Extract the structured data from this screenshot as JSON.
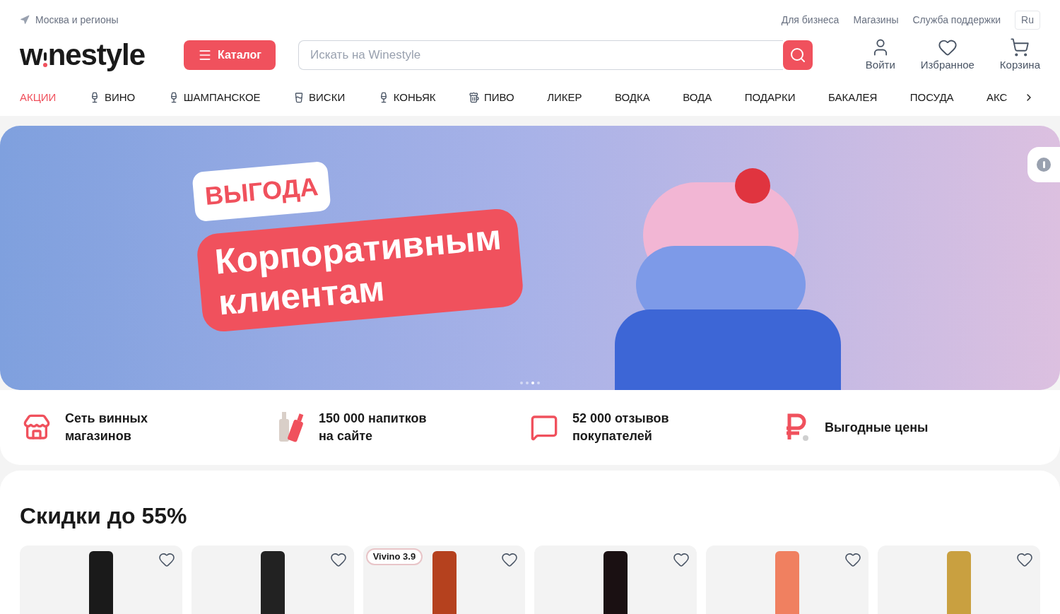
{
  "topbar": {
    "location": "Москва и регионы",
    "links": [
      "Для бизнеса",
      "Магазины",
      "Служба поддержки"
    ],
    "language": "Ru"
  },
  "header": {
    "logo": {
      "before": "w",
      "after": "nestyle"
    },
    "catalog_button": "Каталог",
    "search": {
      "placeholder": "Искать на Winestyle"
    },
    "actions": [
      {
        "kind": "user",
        "label": "Войти"
      },
      {
        "kind": "heart",
        "label": "Избранное"
      },
      {
        "kind": "cart",
        "label": "Корзина"
      }
    ]
  },
  "nav": [
    {
      "label": "АКЦИИ",
      "accent": true
    },
    {
      "label": "ВИНО",
      "accent": false
    },
    {
      "label": "ШАМПАНСКОЕ",
      "accent": false
    },
    {
      "label": "ВИСКИ",
      "accent": false
    },
    {
      "label": "КОНЬЯК",
      "accent": false
    },
    {
      "label": "ПИВО",
      "accent": false
    },
    {
      "label": "ЛИКЕР",
      "accent": false
    },
    {
      "label": "ВОДКА",
      "accent": false
    },
    {
      "label": "ВОДА",
      "accent": false
    },
    {
      "label": "ПОДАРКИ",
      "accent": false
    },
    {
      "label": "БАКАЛЕЯ",
      "accent": false
    },
    {
      "label": "ПОСУДА",
      "accent": false
    },
    {
      "label": "АКС",
      "accent": false
    }
  ],
  "banner": {
    "badge": "ВЫГОДА",
    "headline": [
      "Корпоративным",
      "клиентам"
    ],
    "dots": [
      {
        "selected": false
      },
      {
        "selected": false
      },
      {
        "selected": true
      },
      {
        "selected": false
      }
    ]
  },
  "features": [
    {
      "kind": "store",
      "text": [
        "Сеть винных",
        "магазинов"
      ]
    },
    {
      "kind": "bottles",
      "text": [
        "150 000 напитков",
        "на сайте"
      ]
    },
    {
      "kind": "reviews",
      "text": [
        "52 000 отзывов",
        "покупателей"
      ]
    },
    {
      "kind": "ruble",
      "text": [
        "Выгодные цены"
      ]
    }
  ],
  "discounts": {
    "title": "Скидки до 55%",
    "products": [
      {
        "favorite": false
      },
      {
        "favorite": false
      },
      {
        "favorite": false,
        "rating": "Vivino 3.9"
      },
      {
        "favorite": false
      },
      {
        "favorite": false
      },
      {
        "favorite": false
      }
    ]
  }
}
